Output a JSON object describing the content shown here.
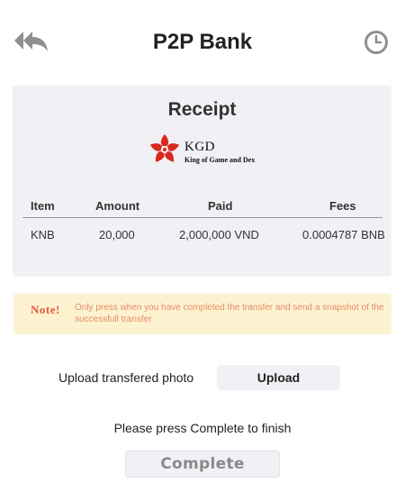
{
  "header": {
    "title": "P2P Bank",
    "back_icon": "reply-all-arrow-icon",
    "history_icon": "clock-icon"
  },
  "receipt": {
    "title": "Receipt",
    "logo": {
      "name": "KGD",
      "tagline": "King of Game and Dex",
      "icon": "star-flower-logo-icon",
      "color": "#d8291f"
    },
    "columns": [
      "Item",
      "Amount",
      "Paid",
      "Fees"
    ],
    "rows": [
      {
        "item": "KNB",
        "amount": "20,000",
        "paid": "2,000,000 VND",
        "fees": "0.0004787 BNB"
      }
    ]
  },
  "note": {
    "label": "Note!",
    "text": "Only press when you have completed the transfer and send a snapshot of the successfull transfer"
  },
  "upload": {
    "label": "Upload transfered photo",
    "button": "Upload"
  },
  "instruction": "Please press Complete to finish",
  "complete_button": "Complete",
  "colors": {
    "panel": "#f1f0f5",
    "note_bg": "#fdf2cf",
    "note_label": "#e55a3c",
    "note_text": "#e78b6a",
    "icon_gray": "#8f8f8f"
  }
}
